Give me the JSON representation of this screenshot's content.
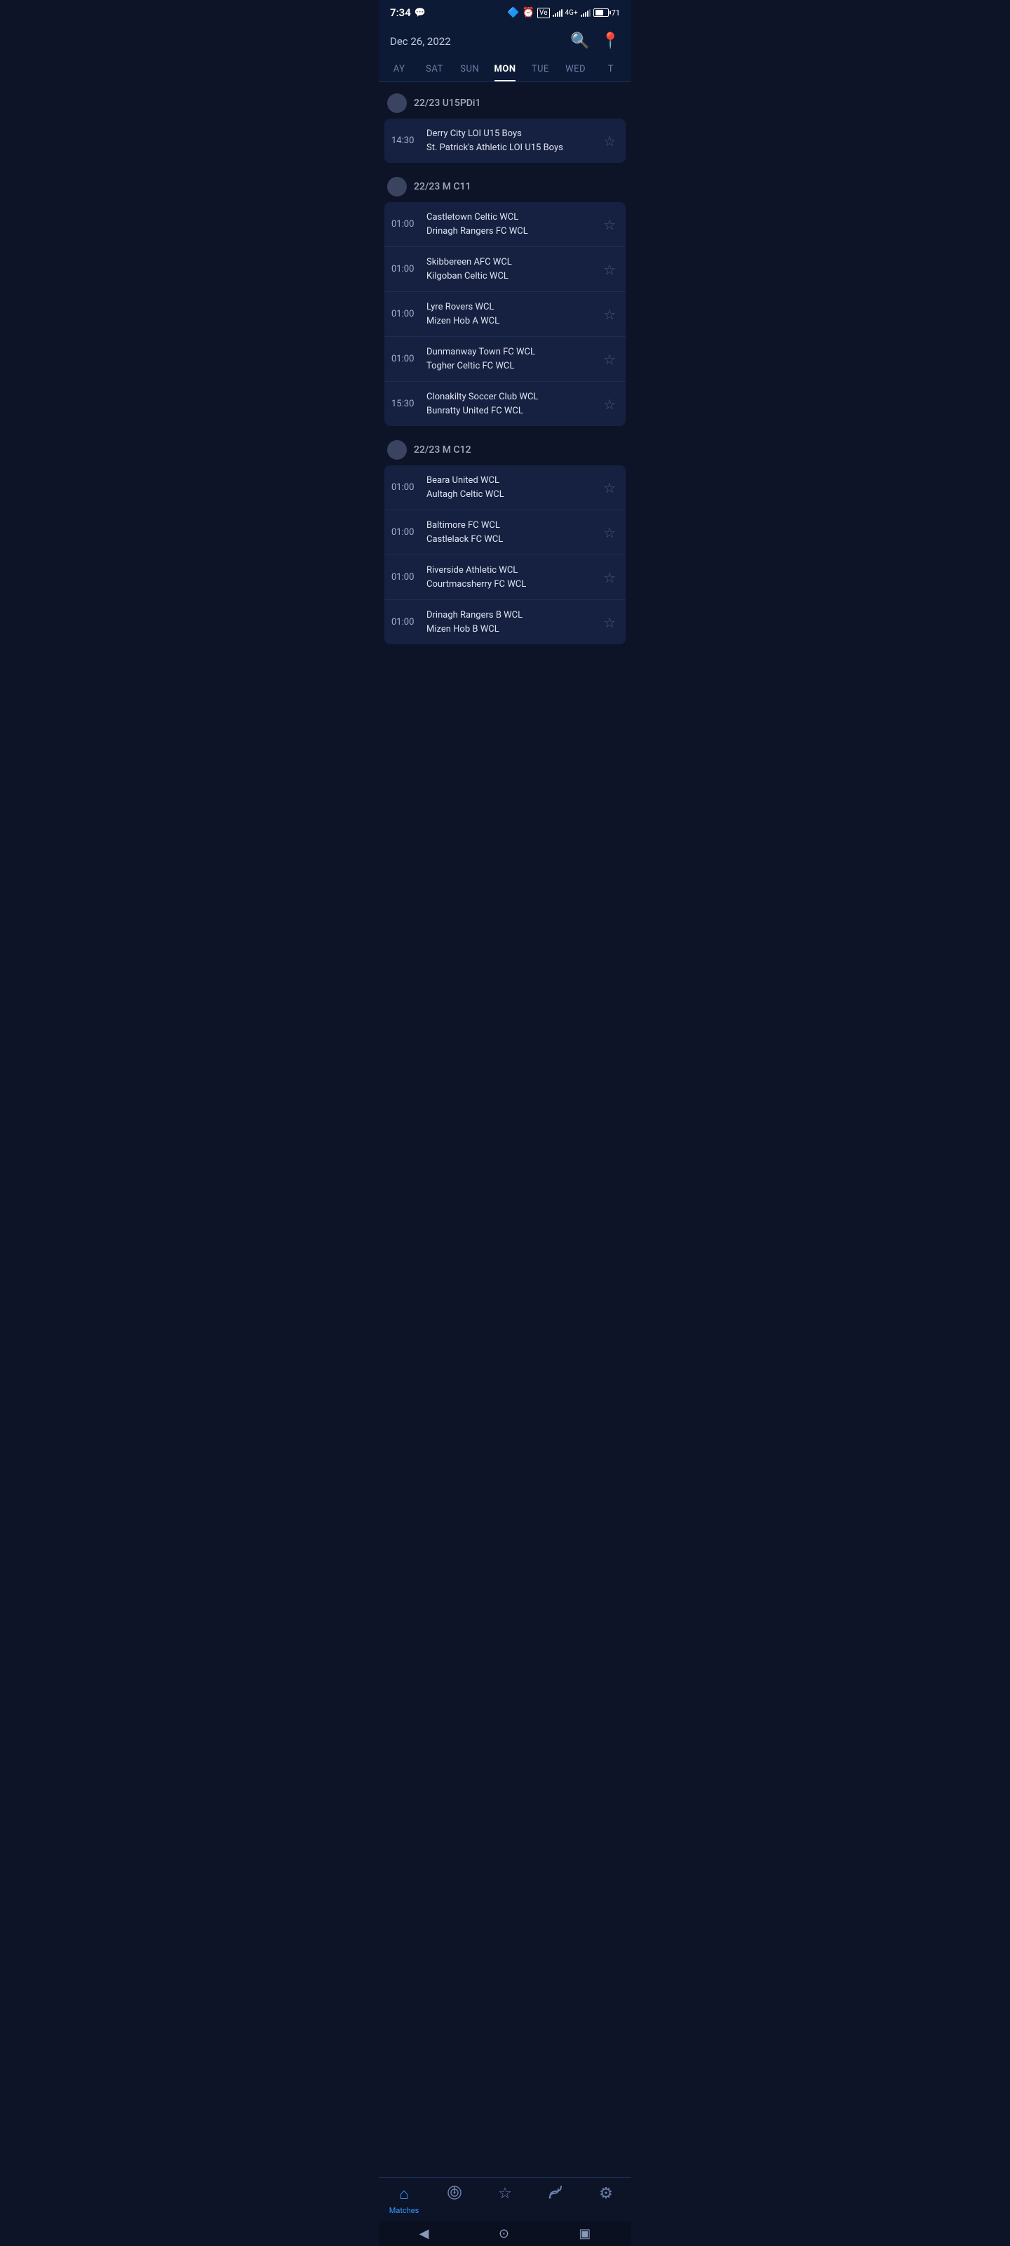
{
  "statusBar": {
    "time": "7:34",
    "batteryPercent": "71"
  },
  "header": {
    "date": "Dec 26, 2022"
  },
  "dayTabs": {
    "days": [
      {
        "id": "fri",
        "label": "AY"
      },
      {
        "id": "sat",
        "label": "SAT"
      },
      {
        "id": "sun",
        "label": "SUN"
      },
      {
        "id": "mon",
        "label": "MON",
        "active": true
      },
      {
        "id": "tue",
        "label": "TUE"
      },
      {
        "id": "wed",
        "label": "WED"
      },
      {
        "id": "thu",
        "label": "T"
      }
    ]
  },
  "sections": [
    {
      "id": "section1",
      "title": "22/23 U15PDi1",
      "matches": [
        {
          "time": "14:30",
          "team1": "Derry City LOI U15 Boys",
          "team2": "St. Patrick's Athletic LOI U15 Boys"
        }
      ]
    },
    {
      "id": "section2",
      "title": "22/23 M C11",
      "matches": [
        {
          "time": "01:00",
          "team1": "Castletown Celtic WCL",
          "team2": "Drinagh Rangers FC WCL"
        },
        {
          "time": "01:00",
          "team1": "Skibbereen AFC WCL",
          "team2": "Kilgoban Celtic WCL"
        },
        {
          "time": "01:00",
          "team1": "Lyre Rovers WCL",
          "team2": "Mizen Hob A WCL"
        },
        {
          "time": "01:00",
          "team1": "Dunmanway Town FC WCL",
          "team2": "Togher Celtic FC WCL"
        },
        {
          "time": "15:30",
          "team1": "Clonakilty Soccer Club WCL",
          "team2": "Bunratty United FC WCL"
        }
      ]
    },
    {
      "id": "section3",
      "title": "22/23 M C12",
      "matches": [
        {
          "time": "01:00",
          "team1": "Beara United WCL",
          "team2": "Aultagh Celtic WCL"
        },
        {
          "time": "01:00",
          "team1": "Baltimore FC WCL",
          "team2": "Castlelack FC WCL"
        },
        {
          "time": "01:00",
          "team1": "Riverside Athletic WCL",
          "team2": "Courtmacsherry FC WCL"
        },
        {
          "time": "01:00",
          "team1": "Drinagh Rangers B WCL",
          "team2": "Mizen Hob B WCL"
        }
      ]
    }
  ],
  "bottomNav": {
    "items": [
      {
        "id": "matches",
        "label": "Matches",
        "active": true,
        "icon": "🏠"
      },
      {
        "id": "radar",
        "label": "",
        "active": false,
        "icon": "📡"
      },
      {
        "id": "favorites",
        "label": "",
        "active": false,
        "icon": "☆"
      },
      {
        "id": "feed",
        "label": "",
        "active": false,
        "icon": "📶"
      },
      {
        "id": "settings",
        "label": "",
        "active": false,
        "icon": "⚙"
      }
    ]
  },
  "systemNav": {
    "back": "◀",
    "home": "⊙",
    "recent": "▣"
  }
}
